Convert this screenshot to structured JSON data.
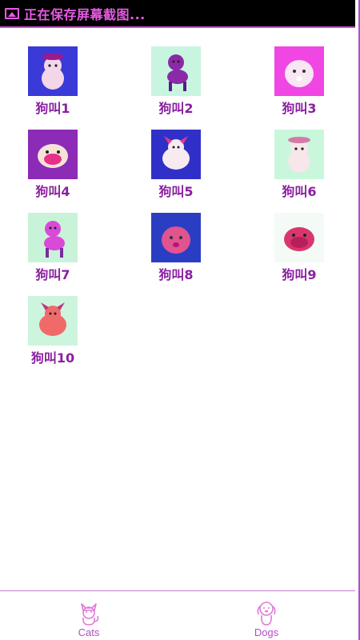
{
  "status": {
    "text": "正在保存屏幕截图..."
  },
  "items": [
    {
      "label": "狗叫1",
      "bg": "#3a3ad8",
      "fg": "#f3d6e8",
      "accent": "#9b1a8c"
    },
    {
      "label": "狗叫2",
      "bg": "#c8f5e0",
      "fg": "#8a2aa6",
      "accent": "#5b1a86"
    },
    {
      "label": "狗叫3",
      "bg": "#f046e4",
      "fg": "#f9e6f4",
      "accent": "#ffffff"
    },
    {
      "label": "狗叫4",
      "bg": "#8b2bb6",
      "fg": "#f6e3d8",
      "accent": "#e8308a"
    },
    {
      "label": "狗叫5",
      "bg": "#3030c8",
      "fg": "#f7eaf0",
      "accent": "#e23c8a"
    },
    {
      "label": "狗叫6",
      "bg": "#c9f7dc",
      "fg": "#f7e6ea",
      "accent": "#d47aa6"
    },
    {
      "label": "狗叫7",
      "bg": "#c9f3d8",
      "fg": "#d94ad8",
      "accent": "#7a2aa0"
    },
    {
      "label": "狗叫8",
      "bg": "#2a3ec4",
      "fg": "#e0548f",
      "accent": "#b8127a"
    },
    {
      "label": "狗叫9",
      "bg": "#f4fbf6",
      "fg": "#d9366e",
      "accent": "#b81f5a"
    },
    {
      "label": "狗叫10",
      "bg": "#cdf5de",
      "fg": "#f06a6a",
      "accent": "#c2367e"
    }
  ],
  "tabs": [
    {
      "label": "Cats"
    },
    {
      "label": "Dogs"
    }
  ],
  "colors": {
    "accent": "#b24cc7",
    "status_bg": "#000000",
    "label": "#8a1fa0"
  }
}
